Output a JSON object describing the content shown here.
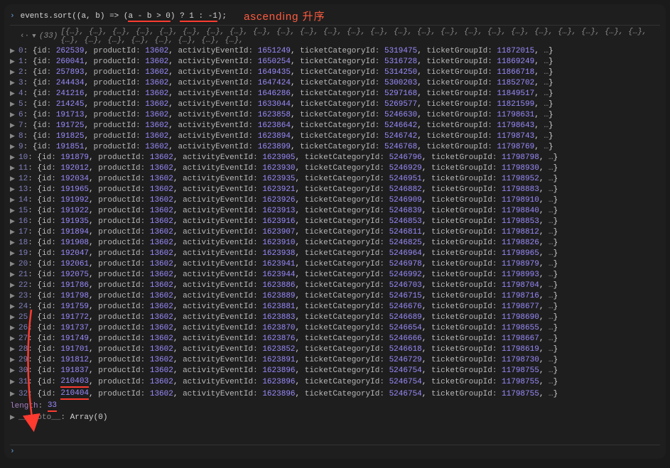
{
  "input": {
    "object": "events",
    "method": "sort",
    "params": "(a, b)",
    "arrow": "=>",
    "body_pre": "(",
    "body_expr": "a - b > 0",
    "body_mid": ") ",
    "ternary": "? 1 : -1",
    "body_post": ");"
  },
  "annotation_text": "ascending 升序",
  "array_count": "(33)",
  "array_preview": "[{…}, {…}, {…}, {…}, {…}, {…}, {…}, {…}, {…}, {…}, {…}, {…}, {…}, {…}, {…}, {…}, {…}, {…}, {…}, {…}, {…}, {…}, {…}, {…}, {…}, {…}, {…}, {…}, {…}, {…}, {…}, {…}, {…},",
  "rows": [
    {
      "idx": "0",
      "id": "262539",
      "productId": "13602",
      "activityEventId": "1651249",
      "ticketCategoryId": "5319475",
      "ticketGroupId": "11872015"
    },
    {
      "idx": "1",
      "id": "260041",
      "productId": "13602",
      "activityEventId": "1650254",
      "ticketCategoryId": "5316728",
      "ticketGroupId": "11869249"
    },
    {
      "idx": "2",
      "id": "257893",
      "productId": "13602",
      "activityEventId": "1649435",
      "ticketCategoryId": "5314250",
      "ticketGroupId": "11866718"
    },
    {
      "idx": "3",
      "id": "244434",
      "productId": "13602",
      "activityEventId": "1647424",
      "ticketCategoryId": "5300203",
      "ticketGroupId": "11852702"
    },
    {
      "idx": "4",
      "id": "241216",
      "productId": "13602",
      "activityEventId": "1646286",
      "ticketCategoryId": "5297168",
      "ticketGroupId": "11849517"
    },
    {
      "idx": "5",
      "id": "214245",
      "productId": "13602",
      "activityEventId": "1633044",
      "ticketCategoryId": "5269577",
      "ticketGroupId": "11821599"
    },
    {
      "idx": "6",
      "id": "191713",
      "productId": "13602",
      "activityEventId": "1623858",
      "ticketCategoryId": "5246630",
      "ticketGroupId": "11798631"
    },
    {
      "idx": "7",
      "id": "191725",
      "productId": "13602",
      "activityEventId": "1623864",
      "ticketCategoryId": "5246642",
      "ticketGroupId": "11798643"
    },
    {
      "idx": "8",
      "id": "191825",
      "productId": "13602",
      "activityEventId": "1623894",
      "ticketCategoryId": "5246742",
      "ticketGroupId": "11798743"
    },
    {
      "idx": "9",
      "id": "191851",
      "productId": "13602",
      "activityEventId": "1623899",
      "ticketCategoryId": "5246768",
      "ticketGroupId": "11798769"
    },
    {
      "idx": "10",
      "id": "191879",
      "productId": "13602",
      "activityEventId": "1623905",
      "ticketCategoryId": "5246796",
      "ticketGroupId": "11798798"
    },
    {
      "idx": "11",
      "id": "192012",
      "productId": "13602",
      "activityEventId": "1623930",
      "ticketCategoryId": "5246929",
      "ticketGroupId": "11798930"
    },
    {
      "idx": "12",
      "id": "192034",
      "productId": "13602",
      "activityEventId": "1623935",
      "ticketCategoryId": "5246951",
      "ticketGroupId": "11798952"
    },
    {
      "idx": "13",
      "id": "191965",
      "productId": "13602",
      "activityEventId": "1623921",
      "ticketCategoryId": "5246882",
      "ticketGroupId": "11798883"
    },
    {
      "idx": "14",
      "id": "191992",
      "productId": "13602",
      "activityEventId": "1623926",
      "ticketCategoryId": "5246909",
      "ticketGroupId": "11798910"
    },
    {
      "idx": "15",
      "id": "191922",
      "productId": "13602",
      "activityEventId": "1623913",
      "ticketCategoryId": "5246839",
      "ticketGroupId": "11798840"
    },
    {
      "idx": "16",
      "id": "191935",
      "productId": "13602",
      "activityEventId": "1623916",
      "ticketCategoryId": "5246853",
      "ticketGroupId": "11798853"
    },
    {
      "idx": "17",
      "id": "191894",
      "productId": "13602",
      "activityEventId": "1623907",
      "ticketCategoryId": "5246811",
      "ticketGroupId": "11798812"
    },
    {
      "idx": "18",
      "id": "191908",
      "productId": "13602",
      "activityEventId": "1623910",
      "ticketCategoryId": "5246825",
      "ticketGroupId": "11798826"
    },
    {
      "idx": "19",
      "id": "192047",
      "productId": "13602",
      "activityEventId": "1623938",
      "ticketCategoryId": "5246964",
      "ticketGroupId": "11798965"
    },
    {
      "idx": "20",
      "id": "192061",
      "productId": "13602",
      "activityEventId": "1623941",
      "ticketCategoryId": "5246978",
      "ticketGroupId": "11798979"
    },
    {
      "idx": "21",
      "id": "192075",
      "productId": "13602",
      "activityEventId": "1623944",
      "ticketCategoryId": "5246992",
      "ticketGroupId": "11798993"
    },
    {
      "idx": "22",
      "id": "191786",
      "productId": "13602",
      "activityEventId": "1623886",
      "ticketCategoryId": "5246703",
      "ticketGroupId": "11798704"
    },
    {
      "idx": "23",
      "id": "191798",
      "productId": "13602",
      "activityEventId": "1623889",
      "ticketCategoryId": "5246715",
      "ticketGroupId": "11798716"
    },
    {
      "idx": "24",
      "id": "191759",
      "productId": "13602",
      "activityEventId": "1623881",
      "ticketCategoryId": "5246676",
      "ticketGroupId": "11798677"
    },
    {
      "idx": "25",
      "id": "191772",
      "productId": "13602",
      "activityEventId": "1623883",
      "ticketCategoryId": "5246689",
      "ticketGroupId": "11798690"
    },
    {
      "idx": "26",
      "id": "191737",
      "productId": "13602",
      "activityEventId": "1623870",
      "ticketCategoryId": "5246654",
      "ticketGroupId": "11798655"
    },
    {
      "idx": "27",
      "id": "191749",
      "productId": "13602",
      "activityEventId": "1623876",
      "ticketCategoryId": "5246666",
      "ticketGroupId": "11798667"
    },
    {
      "idx": "28",
      "id": "191701",
      "productId": "13602",
      "activityEventId": "1623852",
      "ticketCategoryId": "5246618",
      "ticketGroupId": "11798619"
    },
    {
      "idx": "29",
      "id": "191812",
      "productId": "13602",
      "activityEventId": "1623891",
      "ticketCategoryId": "5246729",
      "ticketGroupId": "11798730"
    },
    {
      "idx": "30",
      "id": "191837",
      "productId": "13602",
      "activityEventId": "1623896",
      "ticketCategoryId": "5246754",
      "ticketGroupId": "11798755"
    },
    {
      "idx": "31",
      "id": "210403",
      "productId": "13602",
      "activityEventId": "1623896",
      "ticketCategoryId": "5246754",
      "ticketGroupId": "11798755",
      "mark": true
    },
    {
      "idx": "32",
      "id": "210404",
      "productId": "13602",
      "activityEventId": "1623896",
      "ticketCategoryId": "5246754",
      "ticketGroupId": "11798755",
      "mark": true
    }
  ],
  "length_label": "length",
  "length_value": "33",
  "proto_label": "__proto__",
  "proto_value": "Array(0)",
  "labels": {
    "id": "id",
    "productId": "productId",
    "activityEventId": "activityEventId",
    "ticketCategoryId": "ticketCategoryId",
    "ticketGroupId": "ticketGroupId"
  }
}
